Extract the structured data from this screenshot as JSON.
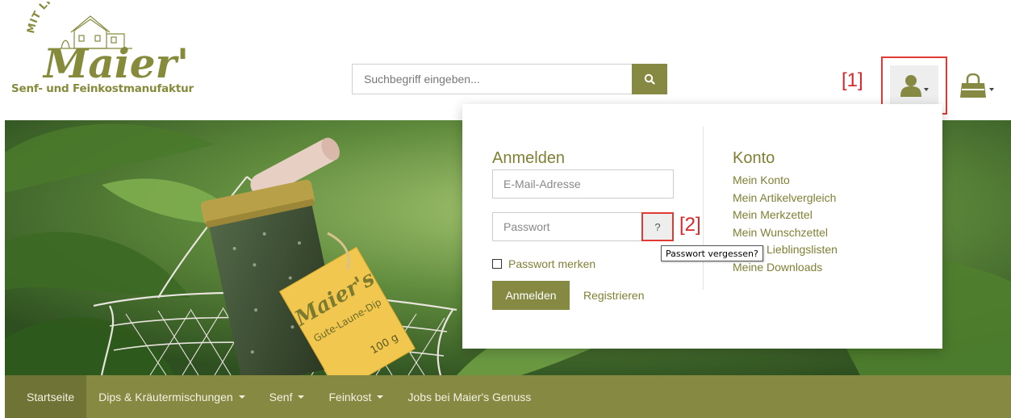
{
  "brand": {
    "arc_text": "MIT LIEBE GEMACHT",
    "name": "Maier's",
    "tagline": "Senf- und Feinkostmanufaktur"
  },
  "search": {
    "placeholder": "Suchbegriff eingeben...",
    "button_icon": "search-icon"
  },
  "annotations": {
    "marker1": "[1]",
    "marker2": "[2]"
  },
  "header_icons": {
    "account": "user-icon",
    "cart": "shopping-bag-icon"
  },
  "hero": {
    "label_brand": "Maier's",
    "label_product": "Gute-Laune-Dip",
    "label_weight": "100 g"
  },
  "login_panel": {
    "title": "Anmelden",
    "email_placeholder": "E-Mail-Adresse",
    "password_placeholder": "Passwort",
    "help_label": "?",
    "remember_label": "Passwort merken",
    "login_button": "Anmelden",
    "register_link": "Registrieren"
  },
  "account_panel": {
    "title": "Konto",
    "links": [
      "Mein Konto",
      "Mein Artikelvergleich",
      "Mein Merkzettel",
      "Mein Wunschzettel",
      "Meine Lieblingslisten",
      "Meine Downloads"
    ]
  },
  "tooltip": "Passwort vergessen?",
  "nav": [
    {
      "label": "Startseite",
      "active": true,
      "dropdown": false
    },
    {
      "label": "Dips & Kräutermischungen",
      "active": false,
      "dropdown": true
    },
    {
      "label": "Senf",
      "active": false,
      "dropdown": true
    },
    {
      "label": "Feinkost",
      "active": false,
      "dropdown": true
    },
    {
      "label": "Jobs bei Maier's Genuss",
      "active": false,
      "dropdown": false
    }
  ],
  "colors": {
    "brand_olive": "#858942",
    "link_olive": "#7f8034",
    "nav_active": "#6f7335",
    "annotation_red": "#d9272b"
  }
}
